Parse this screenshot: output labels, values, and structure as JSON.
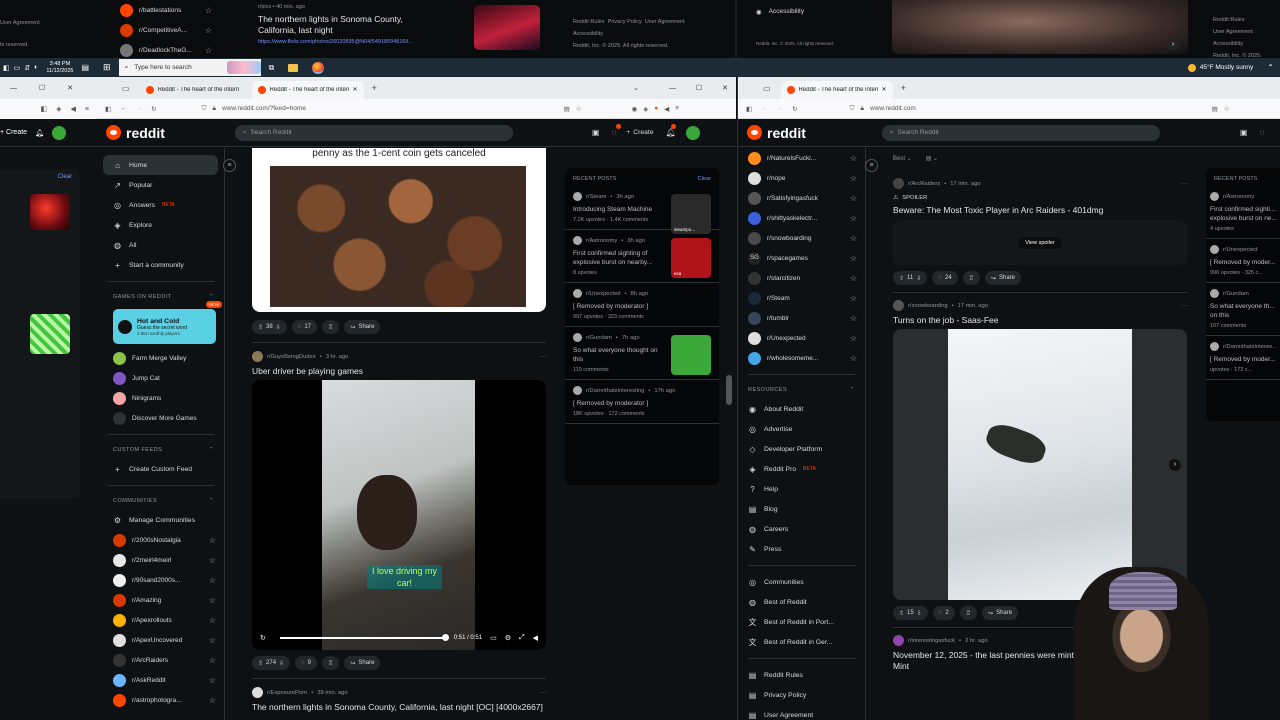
{
  "top_strip": {
    "left_communities": [
      "r/battlestations",
      "r/CompetitiveA...",
      "r/DeadlockTheG..."
    ],
    "left_misc": [
      "User Agreement",
      "ts reserved."
    ],
    "center_post_meta": "r/pics • 40 min. ago",
    "center_post_title": "The northern lights in Sonoma County, California, last night",
    "center_post_link": "https://www.flickr.com/photos/26020895@N04/54918594816/i...",
    "footer_links": [
      "Reddit Rules",
      "Privacy Policy",
      "User Agreement",
      "Accessibility"
    ],
    "footer_copyright": "Reddit, Inc. © 2025. All rights reserved.",
    "right_accessibility": "Accessibility",
    "right_copyright": "Reddit, Inc. © 2025. All rights reserved.",
    "far_right_links": [
      "Reddit Rules",
      "User Agreement",
      "Accessibility",
      "Reddit, Inc. © 2025."
    ]
  },
  "taskbar": {
    "time": "3:48 PM",
    "date": "11/12/2025",
    "search_placeholder": "Type here to search",
    "weather": "45°F  Mostly sunny"
  },
  "browser_left": {
    "tabs": [
      "Reddit - The heart of the intern",
      "Reddit - The heart of the intern"
    ],
    "url": "www.reddit.com/?feed=home",
    "win_controls": [
      "—",
      "☐",
      "✕"
    ]
  },
  "browser_right": {
    "tabs": [
      "Reddit - The heart of the intern"
    ],
    "url": "www.reddit.com"
  },
  "reddit": {
    "logo_text": "reddit",
    "search_placeholder": "Search Reddit",
    "create_label": "Create",
    "sidebar_nav": [
      {
        "label": "Home",
        "icon": "⌂"
      },
      {
        "label": "Popular",
        "icon": "↗"
      },
      {
        "label": "Answers",
        "icon": "◎",
        "badge": "BETA"
      },
      {
        "label": "Explore",
        "icon": "◈"
      },
      {
        "label": "All",
        "icon": "◍"
      },
      {
        "label": "Start a community",
        "icon": "+"
      }
    ],
    "games_header": "GAMES ON REDDIT",
    "game_card": {
      "title": "Hot and Cold",
      "subtitle": "Guess the secret word",
      "players": "2.8M monthly players",
      "badge": "NEW"
    },
    "games": [
      "Farm Merge Valley",
      "Jump Cat",
      "Ninigrams",
      "Discover More Games"
    ],
    "custom_feeds_header": "CUSTOM FEEDS",
    "create_custom_feed": "Create Custom Feed",
    "communities_header": "COMMUNITIES",
    "manage_communities": "Manage Communities",
    "communities": [
      {
        "name": "r/2000sNostalgia",
        "color": "#d93a00"
      },
      {
        "name": "r/2meirl4meirl",
        "color": "#e8e8e8"
      },
      {
        "name": "r/90sand2000s...",
        "color": "#f0f0f0"
      },
      {
        "name": "r/Amazing",
        "color": "#d93a00"
      },
      {
        "name": "r/Apexrollouts",
        "color": "#ffb000"
      },
      {
        "name": "r/ApexUncovered",
        "color": "#e0e0e0"
      },
      {
        "name": "r/ArcRaiders",
        "color": "#333"
      },
      {
        "name": "r/AskReddit",
        "color": "#6bb5ff"
      },
      {
        "name": "r/astrophotogra...",
        "color": "#ff4500"
      }
    ]
  },
  "feed": {
    "post1": {
      "image_caption": "penny as the 1-cent coin gets canceled",
      "votes": "38",
      "comments": "17",
      "share": "Share"
    },
    "post2": {
      "sub": "r/GuysBeingDudes",
      "age": "3 hr. ago",
      "title": "Uber driver be playing games",
      "video_text": "I love driving my car!",
      "time": "0:51 / 0:51",
      "votes": "274",
      "comments": "9",
      "share": "Share"
    },
    "post3": {
      "sub": "r/ExposurePorn",
      "age": "39 min. ago",
      "title": "The northern lights in Sonoma County, California, last night [OC] [4000x2667]"
    }
  },
  "recent_posts": {
    "header": "RECENT POSTS",
    "clear": "Clear",
    "items": [
      {
        "sub": "r/Steam",
        "age": "3h ago",
        "title": "Introducing Steam Machine",
        "stats": "7.2K upvotes · 1.4K comments",
        "thumb": "#2a2a2a",
        "thumb_label": "steampo..."
      },
      {
        "sub": "r/Astronomy",
        "age": "3h ago",
        "title": "First confirmed sighting of explosive burst on nearby...",
        "stats": "8 upvotes",
        "thumb": "#b0141a",
        "thumb_label": "esa"
      },
      {
        "sub": "r/Unexpected",
        "age": "8h ago",
        "title": "[ Removed by moderator ]",
        "stats": "997 upvotes · 323 comments"
      },
      {
        "sub": "r/Gundam",
        "age": "7h ago",
        "title": "So what everyone thought on this",
        "stats": "110 comments",
        "thumb": "#3ca83a"
      },
      {
        "sub": "r/Damnthatsinteresting",
        "age": "17h ago",
        "title": "[ Removed by moderator ]",
        "stats": "18K upvotes · 172 comments"
      }
    ]
  },
  "right_window": {
    "sort_label": "Best",
    "sidebar_communities": [
      {
        "name": "r/NaturelsFucki...",
        "color": "#ff8c1a"
      },
      {
        "name": "r/nope",
        "color": "#ddd"
      },
      {
        "name": "r/Satisfyingasfuck",
        "color": "#555"
      },
      {
        "name": "r/shittyaskelectr...",
        "color": "#3a5fd9"
      },
      {
        "name": "r/snowboarding",
        "color": "#4a4a4a"
      },
      {
        "name": "r/spacegames",
        "color": "#222",
        "label": "SG"
      },
      {
        "name": "r/starcitizen",
        "color": "#333"
      },
      {
        "name": "r/Steam",
        "color": "#1b2838"
      },
      {
        "name": "r/tumblr",
        "color": "#35465c"
      },
      {
        "name": "r/Unexpected",
        "color": "#ddd"
      },
      {
        "name": "r/wholesomeme...",
        "color": "#46a5e5"
      }
    ],
    "resources_header": "RESOURCES",
    "resources": [
      {
        "label": "About Reddit",
        "icon": "◉"
      },
      {
        "label": "Advertise",
        "icon": "◎"
      },
      {
        "label": "Developer Platform",
        "icon": "◇"
      },
      {
        "label": "Reddit Pro",
        "icon": "◈",
        "badge": "BETA"
      },
      {
        "label": "Help",
        "icon": "?"
      },
      {
        "label": "Blog",
        "icon": "▤"
      },
      {
        "label": "Careers",
        "icon": "◍"
      },
      {
        "label": "Press",
        "icon": "✎"
      }
    ],
    "more": [
      {
        "label": "Communities",
        "icon": "◎"
      },
      {
        "label": "Best of Reddit",
        "icon": "◍"
      },
      {
        "label": "Best of Reddit in Port...",
        "icon": "文"
      },
      {
        "label": "Best of Reddit in Ger...",
        "icon": "文"
      }
    ],
    "legal": [
      "Reddit Rules",
      "Privacy Policy",
      "User Agreement"
    ],
    "post1": {
      "sub": "r/ArcRaiders",
      "age": "17 min. ago",
      "spoiler": "SPOILER",
      "title": "Beware: The Most Toxic Player in Arc Raiders - 401dmg",
      "view_spoiler": "View spoiler",
      "votes": "11",
      "comments": "24",
      "share": "Share"
    },
    "post2": {
      "sub": "r/snowboarding",
      "age": "17 min. ago",
      "title": "Turns on the job - Saas-Fee",
      "votes": "15",
      "comments": "2",
      "share": "Share"
    },
    "post3": {
      "sub": "r/interestingasfuck",
      "age": "2 hr. ago",
      "title": "November 12, 2025 - the last pennies were minted at th... Mint"
    },
    "recent_partial": [
      {
        "sub": "r/Astronomy",
        "title": "First confirmed sighti... explosive burst on ne...",
        "stats": "4 upvotes"
      },
      {
        "sub": "r/Unexpected",
        "title": "[ Removed by moder...",
        "stats": "996 upvotes · 325 c..."
      },
      {
        "sub": "r/Gundam",
        "title": "So what everyone th... on this",
        "stats": "107 comments"
      },
      {
        "sub": "r/Damnthatsinteres...",
        "title": "[ Removed by moder...",
        "stats": "upvotes · 172 c..."
      }
    ]
  }
}
